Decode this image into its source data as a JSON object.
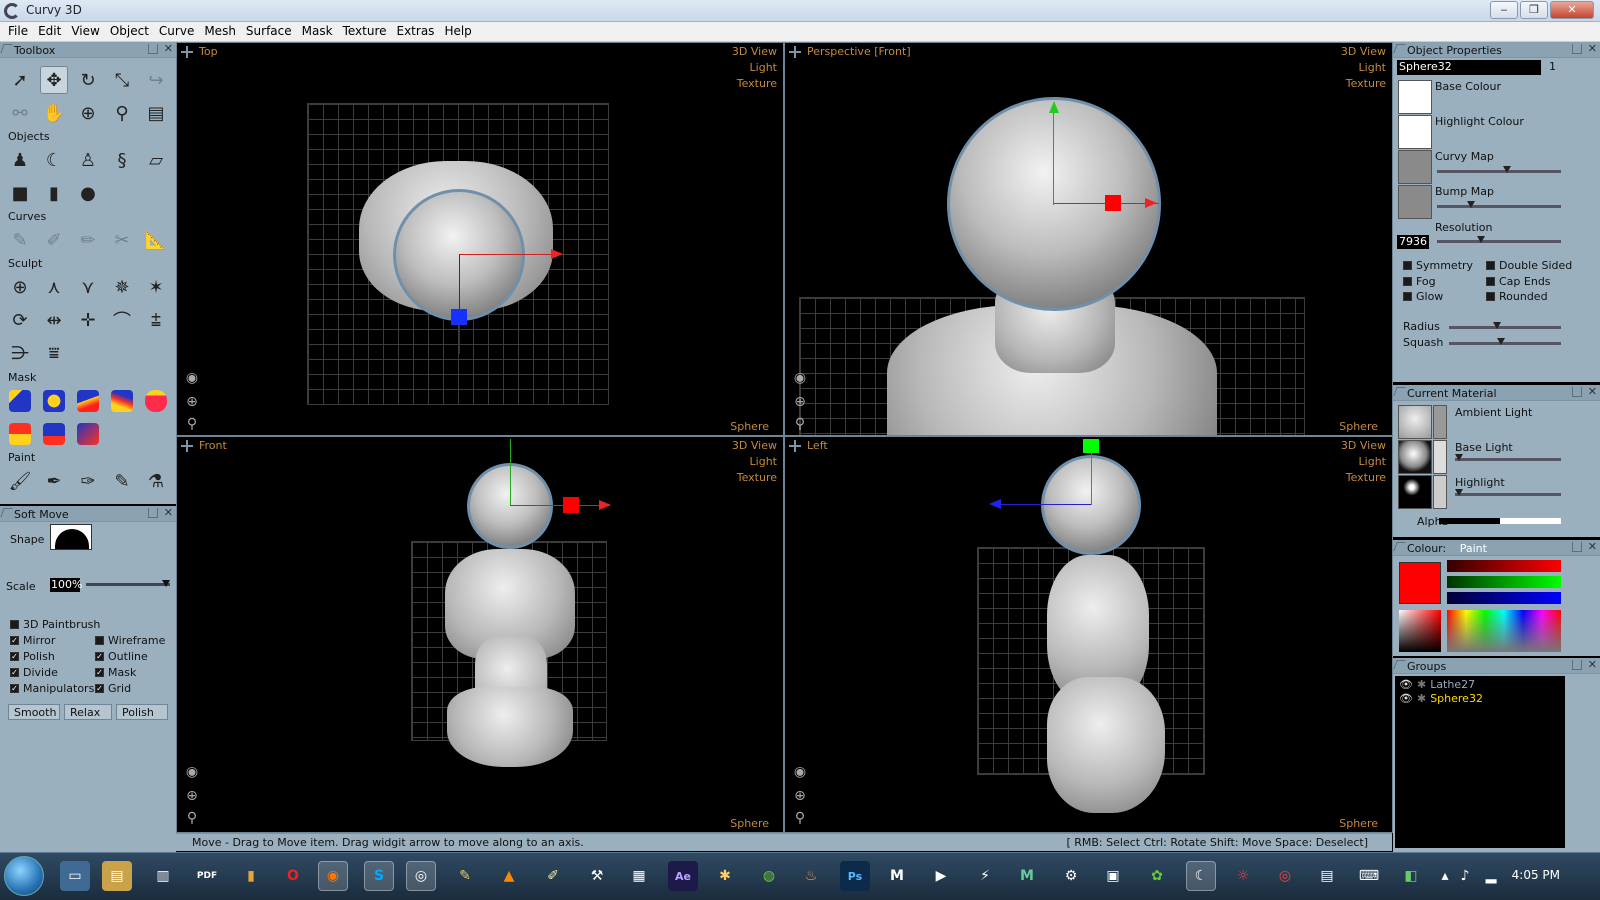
{
  "app": {
    "title": "Curvy 3D",
    "controls": {
      "minimize": "‒",
      "maximize": "❐",
      "close": "✕"
    }
  },
  "menu": [
    "File",
    "Edit",
    "View",
    "Object",
    "Curve",
    "Mesh",
    "Surface",
    "Mask",
    "Texture",
    "Extras",
    "Help"
  ],
  "toolbox": {
    "title": "Toolbox",
    "sections": {
      "objects": "Objects",
      "curves": "Curves",
      "sculpt": "Sculpt",
      "mask": "Mask",
      "paint": "Paint"
    }
  },
  "softmove": {
    "title": "Soft Move",
    "shape_label": "Shape",
    "scale_label": "Scale",
    "scale_value": "100%",
    "checks": [
      {
        "label": "3D Paintbrush",
        "checked": false
      },
      {
        "label": "Mirror",
        "checked": true
      },
      {
        "label": "Wireframe",
        "checked": false
      },
      {
        "label": "Polish",
        "checked": true
      },
      {
        "label": "Outline",
        "checked": true
      },
      {
        "label": "Divide",
        "checked": true
      },
      {
        "label": "Mask",
        "checked": true
      },
      {
        "label": "Manipulators",
        "checked": true
      },
      {
        "label": "Grid",
        "checked": true
      }
    ],
    "buttons": [
      "Smooth",
      "Relax",
      "Polish"
    ]
  },
  "viewports": [
    {
      "name": "Top",
      "right": [
        "3D View",
        "Light",
        "Texture"
      ],
      "footer": "Sphere"
    },
    {
      "name": "Perspective [Front]",
      "right": [
        "3D View",
        "Light",
        "Texture"
      ],
      "footer": "Sphere"
    },
    {
      "name": "Front",
      "right": [
        "3D View",
        "Light",
        "Texture"
      ],
      "footer": "Sphere"
    },
    {
      "name": "Left",
      "right": [
        "3D View",
        "Light",
        "Texture"
      ],
      "footer": "Sphere"
    }
  ],
  "object_properties": {
    "title": "Object Properties",
    "name": "Sphere32",
    "count": "1",
    "base_colour": "Base Colour",
    "highlight_colour": "Highlight Colour",
    "curvy_map": "Curvy Map",
    "bump_map": "Bump Map",
    "resolution_label": "Resolution",
    "resolution_value": "7936",
    "toggles": [
      {
        "label": "Symmetry"
      },
      {
        "label": "Double Sided"
      },
      {
        "label": "Fog"
      },
      {
        "label": "Cap Ends"
      },
      {
        "label": "Glow"
      },
      {
        "label": "Rounded"
      }
    ],
    "radius_label": "Radius",
    "squash_label": "Squash"
  },
  "material": {
    "title": "Current Material",
    "ambient": "Ambient Light",
    "base": "Base Light",
    "highlight": "Highlight",
    "alpha": "Alpha"
  },
  "colour": {
    "title": "Colour:",
    "mode": "Paint",
    "swatch": "#ff0000"
  },
  "groups": {
    "title": "Groups",
    "items": [
      {
        "name": "Lathe27",
        "selected": false
      },
      {
        "name": "Sphere32",
        "selected": true
      }
    ]
  },
  "status": {
    "left": "Move - Drag to Move item. Drag widgit arrow to move along to an axis.",
    "right": "[ RMB: Select   Ctrl: Rotate   Shift: Move   Space: Deselect]"
  },
  "taskbar": {
    "clock": "4:05 PM"
  },
  "colors": {
    "accent": "#c48a3c",
    "panel": "#9ab0be",
    "selected_group": "#ffd700"
  }
}
